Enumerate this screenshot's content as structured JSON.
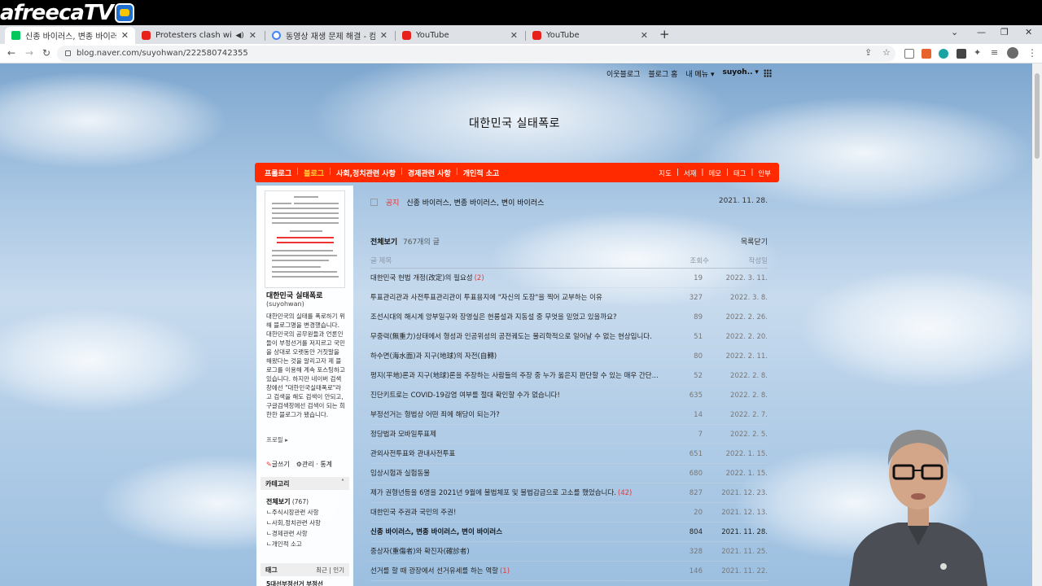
{
  "stream": {
    "brand": "afreecaTV"
  },
  "tabs": [
    {
      "label": "신종 바이러스, 변종 바이러스, 변",
      "favicon": "naver",
      "active": true
    },
    {
      "label": "Protesters clash with police",
      "favicon": "youtube",
      "audio": true
    },
    {
      "label": "동영상 재생 문제 해결 - 컴퓨터",
      "favicon": "google"
    },
    {
      "label": "YouTube",
      "favicon": "youtube"
    },
    {
      "label": "YouTube",
      "favicon": "youtube"
    }
  ],
  "address": {
    "url": "blog.naver.com/suyohwan/222580742355"
  },
  "topnav": {
    "neighbor": "이웃블로그",
    "home": "블로그 홈",
    "my": "내 메뉴",
    "user": "suyoh.."
  },
  "blog": {
    "title": "대한민국 실태폭로"
  },
  "menu": {
    "left": [
      "프롤로그",
      "블로그",
      "사회,정치관련 사항",
      "경제관련 사항",
      "개인적 소고"
    ],
    "right": [
      "지도",
      "서재",
      "메모",
      "태그",
      "안부"
    ]
  },
  "sidebar": {
    "name": "대한민국 실태폭로",
    "id": "(suyohwan)",
    "desc": "대한민국의 실태를 폭로하기 위해 블로그명을 변경했습니다. 대한민국의 공무원들과 언론인들이 부정선거를 저지르고 국민을 상대로 오랫동안 거짓말을 해왔다는 것을 알리고자 제 블로그를 이용해 계속 포스팅하고 있습니다. 하지만 네이버 검색창에선 \"대한민국실태폭로\"라고 검색을 해도 검색이 안되고, 구글검색창에선 검색이 되는 희한한 블로그가 됐습니다.",
    "profile": "프로필 ▸",
    "write": "글쓰기",
    "manage": "관리 · 통계",
    "category_title": "카테고리",
    "categories": [
      {
        "label": "전체보기",
        "count": "(767)"
      },
      {
        "label": "주식시장관련 사항"
      },
      {
        "label": "사회,정치관련 사항"
      },
      {
        "label": "경제관련 사항"
      },
      {
        "label": "개인적 소고"
      }
    ],
    "tag_title": "태그",
    "tag_links": "최근 | 인기",
    "tag_text": "5대선부정선거 부정선"
  },
  "notice": {
    "label": "공지",
    "title": "신종 바이러스, 변종 바이러스, 변이 바이러스",
    "date": "2021. 11. 28."
  },
  "list": {
    "title": "전체보기",
    "count": "767개의 글",
    "toggle": "목록닫기",
    "col_title": "글 제목",
    "col_views": "조회수",
    "col_date": "작성일",
    "rows": [
      {
        "title": "대한민국 헌법 개정(改定)의 필요성",
        "comments": "(2)",
        "views": "19",
        "date": "2022. 3. 11."
      },
      {
        "title": "투표관리관과 사전투표관리관이 투표용지에 \"자신의 도장\"을 찍어 교부하는 이유",
        "views": "327",
        "date": "2022. 3. 8."
      },
      {
        "title": "조선시대의 해시계 앙부일구와 장영실은 현룡설과 지동설 중 무엇을 믿었고 있을까요?",
        "views": "89",
        "date": "2022. 2. 26."
      },
      {
        "title": "무중력(無重力)상태에서 형성과 인공위성의 공전궤도는 물리학적으로 일어날 수 없는 현상입니다.",
        "views": "51",
        "date": "2022. 2. 20."
      },
      {
        "title": "하수면(海水面)과 지구(地球)의 자전(自轉)",
        "views": "80",
        "date": "2022. 2. 11."
      },
      {
        "title": "평지(平地)론과 지구(地球)론을 주장하는 사람들의 주장 중 누가 옳은지 판단할 수 있는 매우 간단...",
        "views": "52",
        "date": "2022. 2. 8."
      },
      {
        "title": "진단키트로는 COVID-19감염 여부를 절대 확인할 수가 없습니다!",
        "views": "635",
        "date": "2022. 2. 8."
      },
      {
        "title": "부정선거는 형법상 어떤 죄에 해당이 되는가?",
        "views": "14",
        "date": "2022. 2. 7."
      },
      {
        "title": "정당법과 모바일투표제",
        "views": "7",
        "date": "2022. 2. 5."
      },
      {
        "title": "관외사전투표와 관내사전투표",
        "views": "651",
        "date": "2022. 1. 15."
      },
      {
        "title": "임상시험과 실험동물",
        "views": "680",
        "date": "2022. 1. 15."
      },
      {
        "title": "제가 권형년등을 6명을 2021년 9월에 불법체포 및 불법감금으로 고소를 했었습니다.",
        "comments": "(42)",
        "views": "827",
        "date": "2021. 12. 23."
      },
      {
        "title": "대한민국 주권과 국민의 주권!",
        "views": "20",
        "date": "2021. 12. 13."
      },
      {
        "title": "신종 바이러스, 변종 바이러스, 변이 바이러스",
        "views": "804",
        "date": "2021. 11. 28.",
        "current": true
      },
      {
        "title": "중상자(重傷者)와 확진자(確診者)",
        "views": "328",
        "date": "2021. 11. 25."
      },
      {
        "title": "선거를 할 때 광장에서 선거유세를 하는 역할",
        "comments": "(1)",
        "views": "146",
        "date": "2021. 11. 22."
      }
    ]
  },
  "colors": {
    "menu_bar": "#ff2a00",
    "menu_active": "#ffd83a",
    "comment": "#e33333"
  }
}
